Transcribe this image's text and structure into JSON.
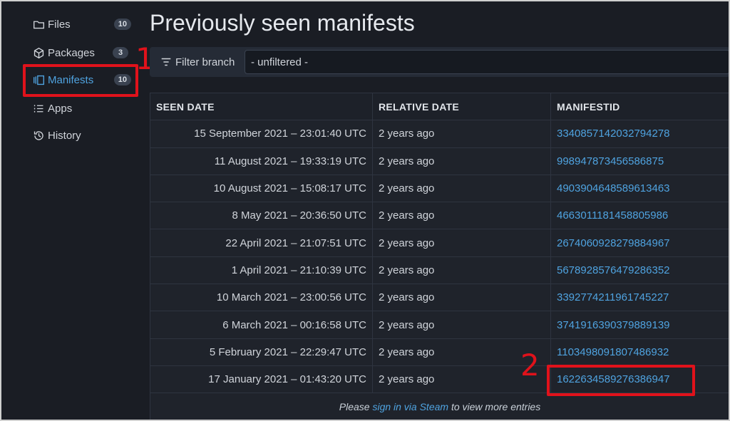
{
  "sidebar": {
    "items": [
      {
        "label": "Files",
        "badge": "10",
        "icon": "folder-icon"
      },
      {
        "label": "Packages",
        "badge": "3",
        "icon": "package-icon"
      },
      {
        "label": "Manifests",
        "badge": "10",
        "icon": "manifest-icon"
      },
      {
        "label": "Apps",
        "badge": "",
        "icon": "list-icon"
      },
      {
        "label": "History",
        "badge": "",
        "icon": "history-icon"
      }
    ]
  },
  "annotations": {
    "first": "1",
    "second": "2",
    "color": "#e0121b"
  },
  "main": {
    "title": "Previously seen manifests",
    "filter": {
      "label": "Filter branch",
      "value": "- unfiltered -"
    },
    "table": {
      "headers": [
        "SEEN DATE",
        "RELATIVE DATE",
        "MANIFESTID"
      ],
      "rows": [
        {
          "date": "15 September 2021 – 23:01:40 UTC",
          "relative": "2 years ago",
          "id": "3340857142032794278"
        },
        {
          "date": "11 August 2021 – 19:33:19 UTC",
          "relative": "2 years ago",
          "id": "998947873456586875"
        },
        {
          "date": "10 August 2021 – 15:08:17 UTC",
          "relative": "2 years ago",
          "id": "4903904648589613463"
        },
        {
          "date": "8 May 2021 – 20:36:50 UTC",
          "relative": "2 years ago",
          "id": "4663011181458805986"
        },
        {
          "date": "22 April 2021 – 21:07:51 UTC",
          "relative": "2 years ago",
          "id": "2674060928279884967"
        },
        {
          "date": "1 April 2021 – 21:10:39 UTC",
          "relative": "2 years ago",
          "id": "5678928576479286352"
        },
        {
          "date": "10 March 2021 – 23:00:56 UTC",
          "relative": "2 years ago",
          "id": "3392774211961745227"
        },
        {
          "date": "6 March 2021 – 00:16:58 UTC",
          "relative": "2 years ago",
          "id": "3741916390379889139"
        },
        {
          "date": "5 February 2021 – 22:29:47 UTC",
          "relative": "2 years ago",
          "id": "1103498091807486932"
        },
        {
          "date": "17 January 2021 – 01:43:20 UTC",
          "relative": "2 years ago",
          "id": "1622634589276386947"
        }
      ],
      "footer": {
        "pre": "Please ",
        "link": "sign in via Steam",
        "post": " to view more entries"
      }
    }
  },
  "colors": {
    "background": "#1a1d24",
    "accent": "#4fa3e0",
    "annotation": "#e0121b"
  }
}
